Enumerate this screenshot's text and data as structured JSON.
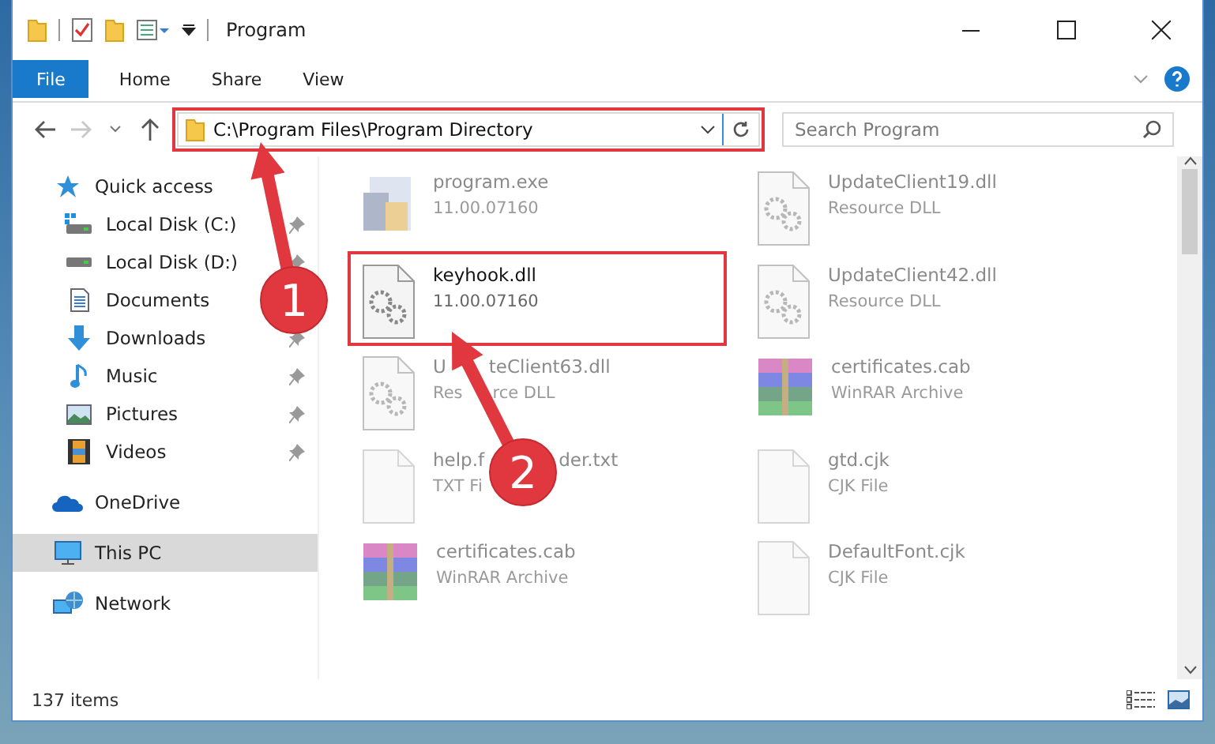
{
  "window": {
    "title": "Program"
  },
  "ribbon_tabs": [
    {
      "label": "File",
      "kind": "file"
    },
    {
      "label": "Home",
      "kind": "tab"
    },
    {
      "label": "Share",
      "kind": "tab"
    },
    {
      "label": "View",
      "kind": "tab"
    }
  ],
  "address_bar": {
    "path": "C:\\Program Files\\Program Directory",
    "highlighted": true
  },
  "search": {
    "placeholder": "Search Program"
  },
  "sidebar": {
    "items": [
      {
        "label": "Quick access",
        "kind": "star",
        "selected": false,
        "children": [
          {
            "label": "Local Disk (C:)",
            "kind": "disk-windows",
            "pinned": true
          },
          {
            "label": "Local Disk (D:)",
            "kind": "disk",
            "pinned": true
          },
          {
            "label": "Documents",
            "kind": "documents",
            "pinned": false
          },
          {
            "label": "Downloads",
            "kind": "downloads",
            "pinned": true
          },
          {
            "label": "Music",
            "kind": "music",
            "pinned": true
          },
          {
            "label": "Pictures",
            "kind": "pictures",
            "pinned": true
          },
          {
            "label": "Videos",
            "kind": "videos",
            "pinned": true
          }
        ]
      },
      {
        "label": "OneDrive",
        "kind": "cloud",
        "selected": false
      },
      {
        "label": "This PC",
        "kind": "pc",
        "selected": true
      },
      {
        "label": "Network",
        "kind": "network",
        "selected": false
      }
    ]
  },
  "files": [
    {
      "name": "program.exe",
      "detail": "11.00.07160",
      "kind": "exe",
      "blurred": true,
      "highlighted": false
    },
    {
      "name": "UpdateClient19.dll",
      "detail": "Resource DLL",
      "kind": "dll",
      "blurred": true,
      "highlighted": false
    },
    {
      "name": "keyhook.dll",
      "detail": "11.00.07160",
      "kind": "dll",
      "blurred": false,
      "highlighted": true
    },
    {
      "name": "UpdateClient42.dll",
      "detail": "Resource DLL",
      "kind": "dll",
      "blurred": true,
      "highlighted": false
    },
    {
      "name": "U",
      "name_end": "teClient63.dll",
      "detail": "Res",
      "detail_end": "rce DLL",
      "kind": "dll",
      "blurred": true,
      "highlighted": false
    },
    {
      "name": "certificates.cab",
      "detail": "WinRAR Archive",
      "kind": "archive",
      "blurred": true,
      "highlighted": false
    },
    {
      "name": "help.f",
      "name_end": "der.txt",
      "detail": "TXT Fi",
      "kind": "text",
      "blurred": true,
      "highlighted": false
    },
    {
      "name": "gtd.cjk",
      "detail": "CJK File",
      "kind": "text",
      "blurred": true,
      "highlighted": false
    },
    {
      "name": "certificates.cab",
      "detail": "WinRAR Archive",
      "kind": "archive",
      "blurred": true,
      "highlighted": false
    },
    {
      "name": "DefaultFont.cjk",
      "detail": "CJK File",
      "kind": "text",
      "blurred": true,
      "highlighted": false
    }
  ],
  "status_bar": {
    "item_count": "137 items"
  },
  "annotations": [
    {
      "number": "1"
    },
    {
      "number": "2"
    }
  ]
}
